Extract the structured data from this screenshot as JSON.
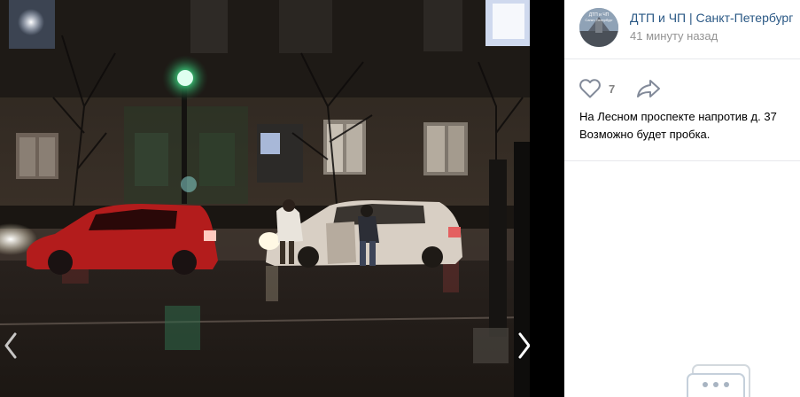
{
  "post": {
    "group_name": "ДТП и ЧП | Санкт-Петербург",
    "time": "41 минуту назад",
    "likes": "7",
    "text_lines": [
      "На Лесном проспекте напротив д. 37",
      "Возможно будет пробка."
    ]
  },
  "avatar": {
    "lines": [
      "ДТП и ЧП",
      "Санкт-Петербург"
    ]
  },
  "icons": {
    "like": "heart-icon",
    "share": "share-arrow-icon",
    "prev": "chevron-left-icon",
    "next": "chevron-right-icon",
    "chat": "chat-bubble-icon"
  },
  "colors": {
    "link": "#2a5885",
    "meta": "#939393",
    "icon": "#828a99"
  }
}
